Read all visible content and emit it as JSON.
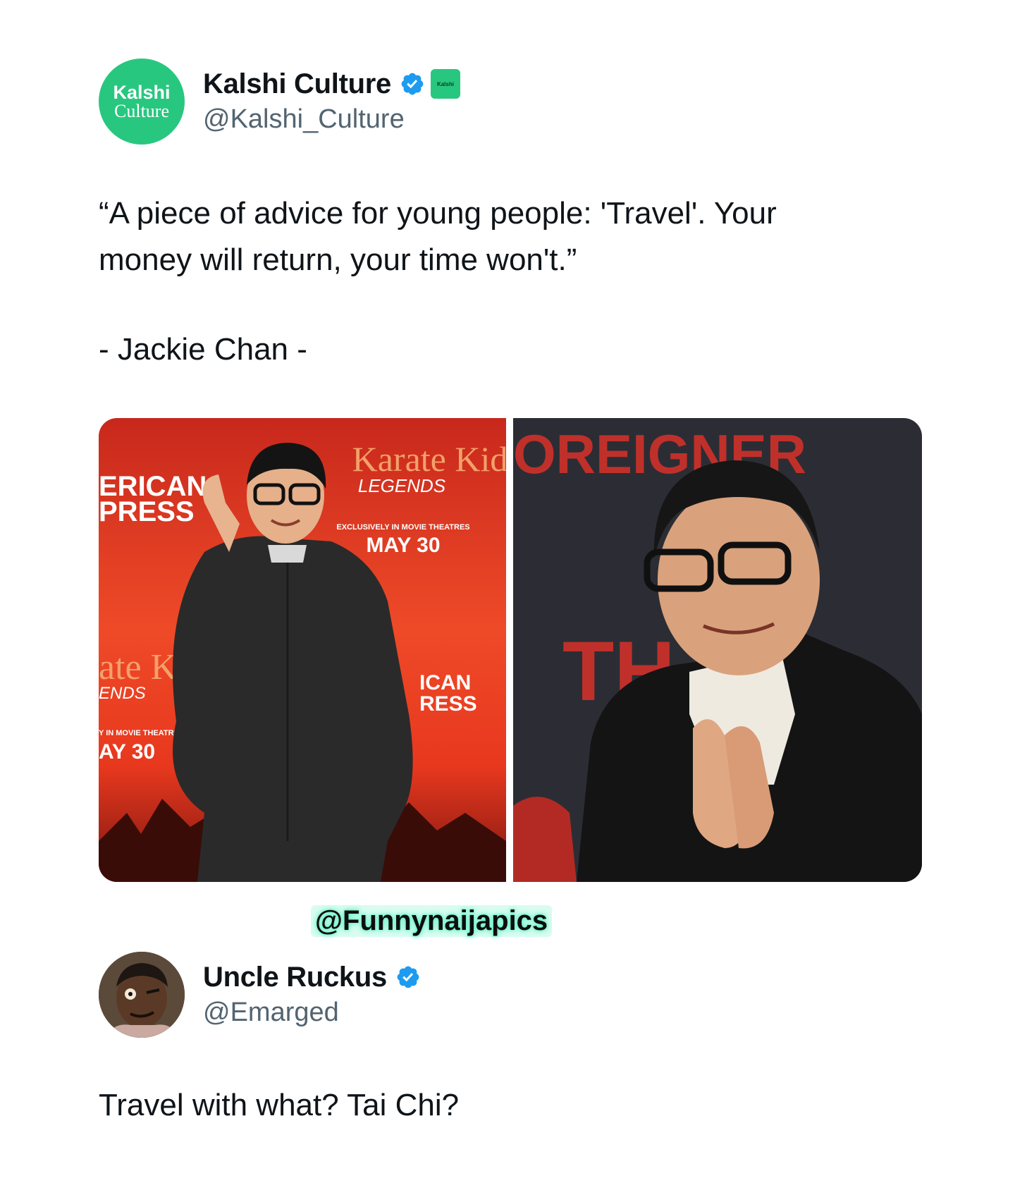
{
  "tweet": {
    "author": {
      "avatar_line1": "Kalshi",
      "avatar_line2": "Culture",
      "display_name": "Kalshi Culture",
      "handle": "@Kalshi_Culture",
      "affiliate_badge_text": "Kalshi"
    },
    "text_line1": "“A piece of advice for young people: 'Travel'. Your",
    "text_line2": "money will return, your time won't.”",
    "attribution": "- Jackie Chan -",
    "photos": {
      "left": {
        "poster_title": "Karate Kid",
        "poster_subtitle": "LEGENDS",
        "poster_tagline": "EXCLUSIVELY IN MOVIE THEATRES",
        "poster_date": "MAY 30",
        "side_text_1": "ERICAN",
        "side_text_2": "PRESS",
        "bottom_title": "ate Kid",
        "bottom_subtitle": "ENDS",
        "bottom_tagline": "Y IN MOVIE THEATRES",
        "bottom_date": "AY 30",
        "right_text_1": "ICAN",
        "right_text_2": "RESS"
      },
      "right": {
        "backdrop_text": "OREIGNER",
        "backdrop_text_2": "TH"
      }
    }
  },
  "watermark": "@Funnynaijapics",
  "reply": {
    "author": {
      "display_name": "Uncle Ruckus",
      "handle": "@Emarged"
    },
    "text": "Travel with what? Tai Chi?"
  },
  "colors": {
    "kalshi_green": "#28c77f",
    "verified_blue": "#1d9bf0",
    "handle_gray": "#536471",
    "watermark_glow": "#6df2c8"
  },
  "icons": {
    "verified": "verified-badge-icon",
    "affiliate": "kalshi-affiliate-badge-icon"
  }
}
